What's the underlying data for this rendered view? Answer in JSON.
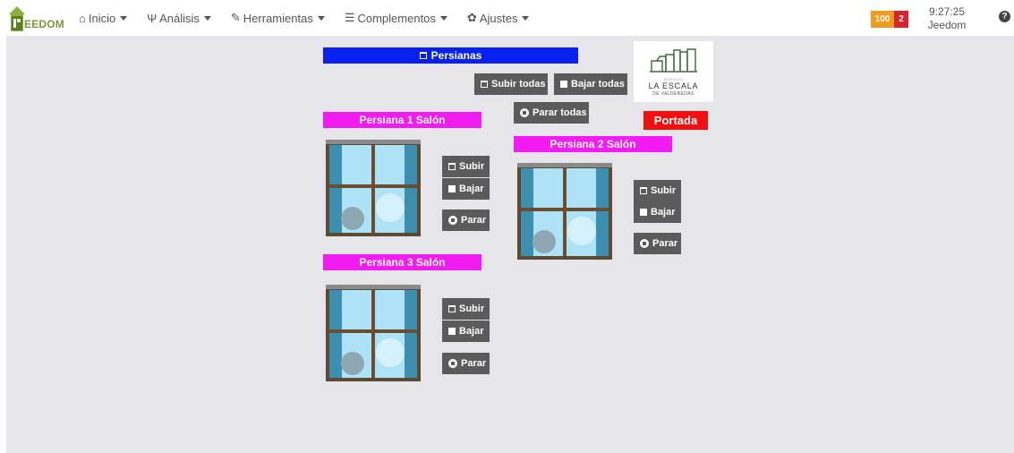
{
  "navbar": {
    "logo_text": "EEDOM",
    "menu": [
      {
        "icon": "home-icon",
        "glyph": "⌂",
        "label": "Inicio"
      },
      {
        "icon": "stethoscope-icon",
        "glyph": "Ψ",
        "label": "Análisis"
      },
      {
        "icon": "wrench-icon",
        "glyph": "✎",
        "label": "Herramientas"
      },
      {
        "icon": "list-icon",
        "glyph": "☰",
        "label": "Complementos"
      },
      {
        "icon": "gear-icon",
        "glyph": "✿",
        "label": "Ajustes"
      }
    ],
    "badge_orange": "100",
    "badge_red": "2",
    "time": "9:27:25",
    "user": "Jeedom",
    "help_glyph": "?"
  },
  "main": {
    "title": "Persianas",
    "subir_todas": "Subir todas",
    "bajar_todas": "Bajar todas",
    "parar_todas": "Parar todas",
    "portada": "Portada",
    "logo_card": {
      "small": "EDIFICIO",
      "name": "LA ESCALA",
      "sub": "DE VALDEBEDAS"
    },
    "blinds": [
      {
        "title": "Persiana 1 Salón",
        "subir": "Subir",
        "bajar": "Bajar",
        "parar": "Parar"
      },
      {
        "title": "Persiana 2 Salón",
        "subir": "Subir",
        "bajar": "Bajar",
        "parar": "Parar"
      },
      {
        "title": "Persiana 3 Salón",
        "subir": "Subir",
        "bajar": "Bajar",
        "parar": "Parar"
      }
    ]
  },
  "colors": {
    "title_blue": "#0820f0",
    "blind_magenta": "#f21cf2",
    "portada_red": "#f20f0f",
    "button_gray": "#5b5b5b",
    "badge_orange": "#f29c1f",
    "badge_red": "#d9232d",
    "background": "#e6e6ea"
  }
}
